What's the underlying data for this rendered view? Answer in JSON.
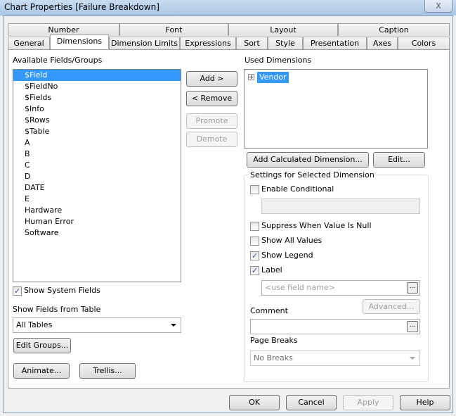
{
  "window": {
    "title": "Chart Properties [Failure Breakdown]",
    "close": "X"
  },
  "tabs_top": [
    "Number",
    "Font",
    "Layout",
    "Caption"
  ],
  "tabs_bottom": [
    "General",
    "Dimensions",
    "Dimension Limits",
    "Expressions",
    "Sort",
    "Style",
    "Presentation",
    "Axes",
    "Colors"
  ],
  "active_tab": "Dimensions",
  "available": {
    "label": "Available Fields/Groups",
    "items": [
      "$Field",
      "$FieldNo",
      "$Fields",
      "$Info",
      "$Rows",
      "$Table",
      "A",
      "B",
      "C",
      "D",
      "DATE",
      "E",
      "Hardware",
      "Human Error",
      "Software"
    ],
    "selected": "$Field"
  },
  "buttons": {
    "add": "Add >",
    "remove": "< Remove",
    "promote": "Promote",
    "demote": "Demote",
    "add_calc": "Add Calculated Dimension...",
    "edit": "Edit...",
    "edit_groups": "Edit Groups...",
    "animate": "Animate...",
    "trellis": "Trellis...",
    "advanced": "Advanced...",
    "ok": "OK",
    "cancel": "Cancel",
    "apply": "Apply",
    "help": "Help",
    "dots": "..."
  },
  "used": {
    "label": "Used Dimensions",
    "items": [
      "Vendor"
    ]
  },
  "show_system_fields": {
    "label": "Show System Fields",
    "checked": true
  },
  "show_fields_from": {
    "label": "Show Fields from Table",
    "value": "All Tables"
  },
  "settings": {
    "title": "Settings for Selected Dimension",
    "enable_conditional": {
      "label": "Enable Conditional",
      "checked": false
    },
    "suppress_null": {
      "label": "Suppress When Value Is Null",
      "checked": false
    },
    "show_all_values": {
      "label": "Show All Values",
      "checked": false
    },
    "show_legend": {
      "label": "Show Legend",
      "checked": true
    },
    "label": {
      "label": "Label",
      "checked": true
    },
    "label_placeholder": "<use field name>",
    "comment_label": "Comment",
    "page_breaks_label": "Page Breaks",
    "page_breaks_value": "No Breaks"
  },
  "check": "✓"
}
